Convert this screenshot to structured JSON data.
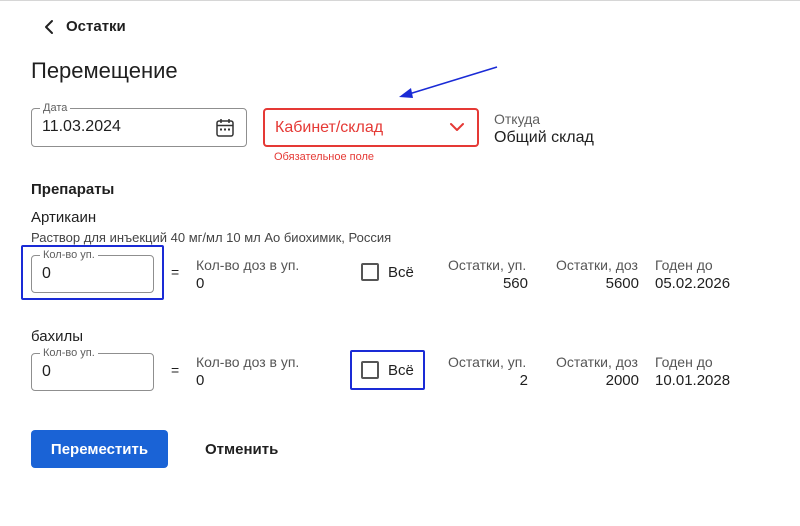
{
  "header": {
    "back_label": "Остатки"
  },
  "page": {
    "title": "Перемещение"
  },
  "date_field": {
    "label": "Дата",
    "value": "11.03.2024"
  },
  "destination": {
    "placeholder": "Кабинет/склад",
    "error": "Обязательное поле"
  },
  "source": {
    "label": "Откуда",
    "value": "Общий склад"
  },
  "section_title": "Препараты",
  "items": [
    {
      "name": "Артикаин",
      "description": "Раствор для инъекций 40 мг/мл 10 мл Ао биохимик, Россия",
      "qty_label": "Кол-во уп.",
      "qty_value": "0",
      "equals": "=",
      "doses_label": "Кол-во доз в уп.",
      "doses_value": "0",
      "all_label": "Всё",
      "stock_packs_label": "Остатки, уп.",
      "stock_packs_value": "560",
      "stock_doses_label": "Остатки, доз",
      "stock_doses_value": "5600",
      "expiry_label": "Годен до",
      "expiry_value": "05.02.2026"
    },
    {
      "name": "бахилы",
      "description": "",
      "qty_label": "Кол-во уп.",
      "qty_value": "0",
      "equals": "=",
      "doses_label": "Кол-во доз в уп.",
      "doses_value": "0",
      "all_label": "Всё",
      "stock_packs_label": "Остатки, уп.",
      "stock_packs_value": "2",
      "stock_doses_label": "Остатки, доз",
      "stock_doses_value": "2000",
      "expiry_label": "Годен до",
      "expiry_value": "10.01.2028"
    }
  ],
  "actions": {
    "submit_label": "Переместить",
    "cancel_label": "Отменить"
  },
  "colors": {
    "error": "#e53935",
    "primary": "#1a63d6",
    "annotation": "#1a2bd6"
  },
  "icons": {
    "back": "chevron-left-icon",
    "calendar": "calendar-icon",
    "dropdown": "chevron-down-icon",
    "annotation": "arrow-icon"
  }
}
